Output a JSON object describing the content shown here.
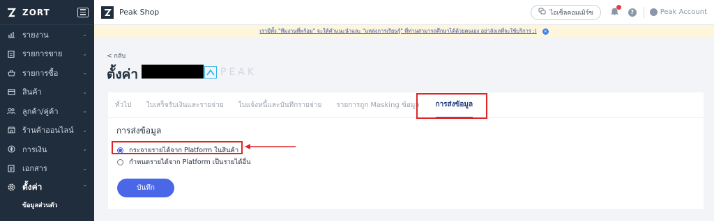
{
  "sidebar": {
    "brand": "ZORT",
    "items": [
      {
        "label": "รายงาน",
        "icon": "chart-icon"
      },
      {
        "label": "รายการขาย",
        "icon": "clipboard-icon"
      },
      {
        "label": "รายการซื้อ",
        "icon": "basket-icon"
      },
      {
        "label": "สินค้า",
        "icon": "box-icon"
      },
      {
        "label": "ลูกค้า/คู่ค้า",
        "icon": "users-icon"
      },
      {
        "label": "ร้านค้าออนไลน์",
        "icon": "store-icon"
      },
      {
        "label": "การเงิน",
        "icon": "money-icon"
      },
      {
        "label": "เอกสาร",
        "icon": "document-icon"
      },
      {
        "label": "ตั้งค่า",
        "icon": "gear-icon"
      }
    ],
    "sub_item": "ข้อมูลส่วนตัว"
  },
  "header": {
    "shop_name": "Peak Shop",
    "connect_label": "ไอเซ็ลคอมเมิร์ซ",
    "account_label": "Peak Account"
  },
  "notice": {
    "text": "เรามีทั้ง \"ทีมงานที่พร้อม\" จะให้คำแนะนำและ \"แหล่งการเรียนรู้\" ที่ท่านสามารถศึกษาได้ด้วยตนเอง อย่าลังเลที่จะใช้บริการ :)"
  },
  "page": {
    "back_label": "< กลับ",
    "title": "ตั้งค่า",
    "logo_word": "PEAK"
  },
  "tabs": [
    {
      "label": "ทั่วไป"
    },
    {
      "label": "ใบเสร็จรับเงินและรายจ่าย"
    },
    {
      "label": "ใบแจ้งหนี้และบันทึกรายจ่าย"
    },
    {
      "label": "รายการถูก Masking ข้อมูล"
    },
    {
      "label": "การส่งข้อมูล"
    }
  ],
  "form": {
    "section_title": "การส่งข้อมูล",
    "options": [
      {
        "label": "กระจายรายได้จาก Platform ในสินค้า",
        "selected": true
      },
      {
        "label": "กำหนดรายได้จาก Platform เป็นรายได้อื่น",
        "selected": false
      }
    ],
    "save_label": "บันทึก"
  },
  "colors": {
    "sidebar_bg": "#1f2d3d",
    "accent": "#4a67e8",
    "highlight": "#e02424"
  }
}
